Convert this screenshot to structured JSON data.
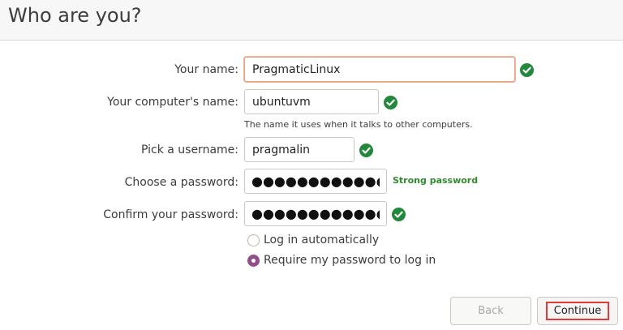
{
  "page": {
    "title": "Who are you?"
  },
  "form": {
    "name": {
      "label": "Your name:",
      "value": "PragmaticLinux"
    },
    "computer": {
      "label": "Your computer's name:",
      "value": "ubuntuvm",
      "hint": "The name it uses when it talks to other computers."
    },
    "username": {
      "label": "Pick a username:",
      "value": "pragmalin"
    },
    "password": {
      "label": "Choose a password:",
      "value": "●●●●●●●●●●●●",
      "strength": "Strong password"
    },
    "confirm": {
      "label": "Confirm your password:",
      "value": "●●●●●●●●●●●●"
    },
    "login_options": [
      {
        "label": "Log in automatically",
        "selected": false
      },
      {
        "label": "Require my password to log in",
        "selected": true
      }
    ]
  },
  "buttons": {
    "back": "Back",
    "continue": "Continue"
  },
  "colors": {
    "check": "#22883a",
    "accent": "#924d8b",
    "focus": "#e9a182",
    "highlight": "#e03a3a"
  }
}
